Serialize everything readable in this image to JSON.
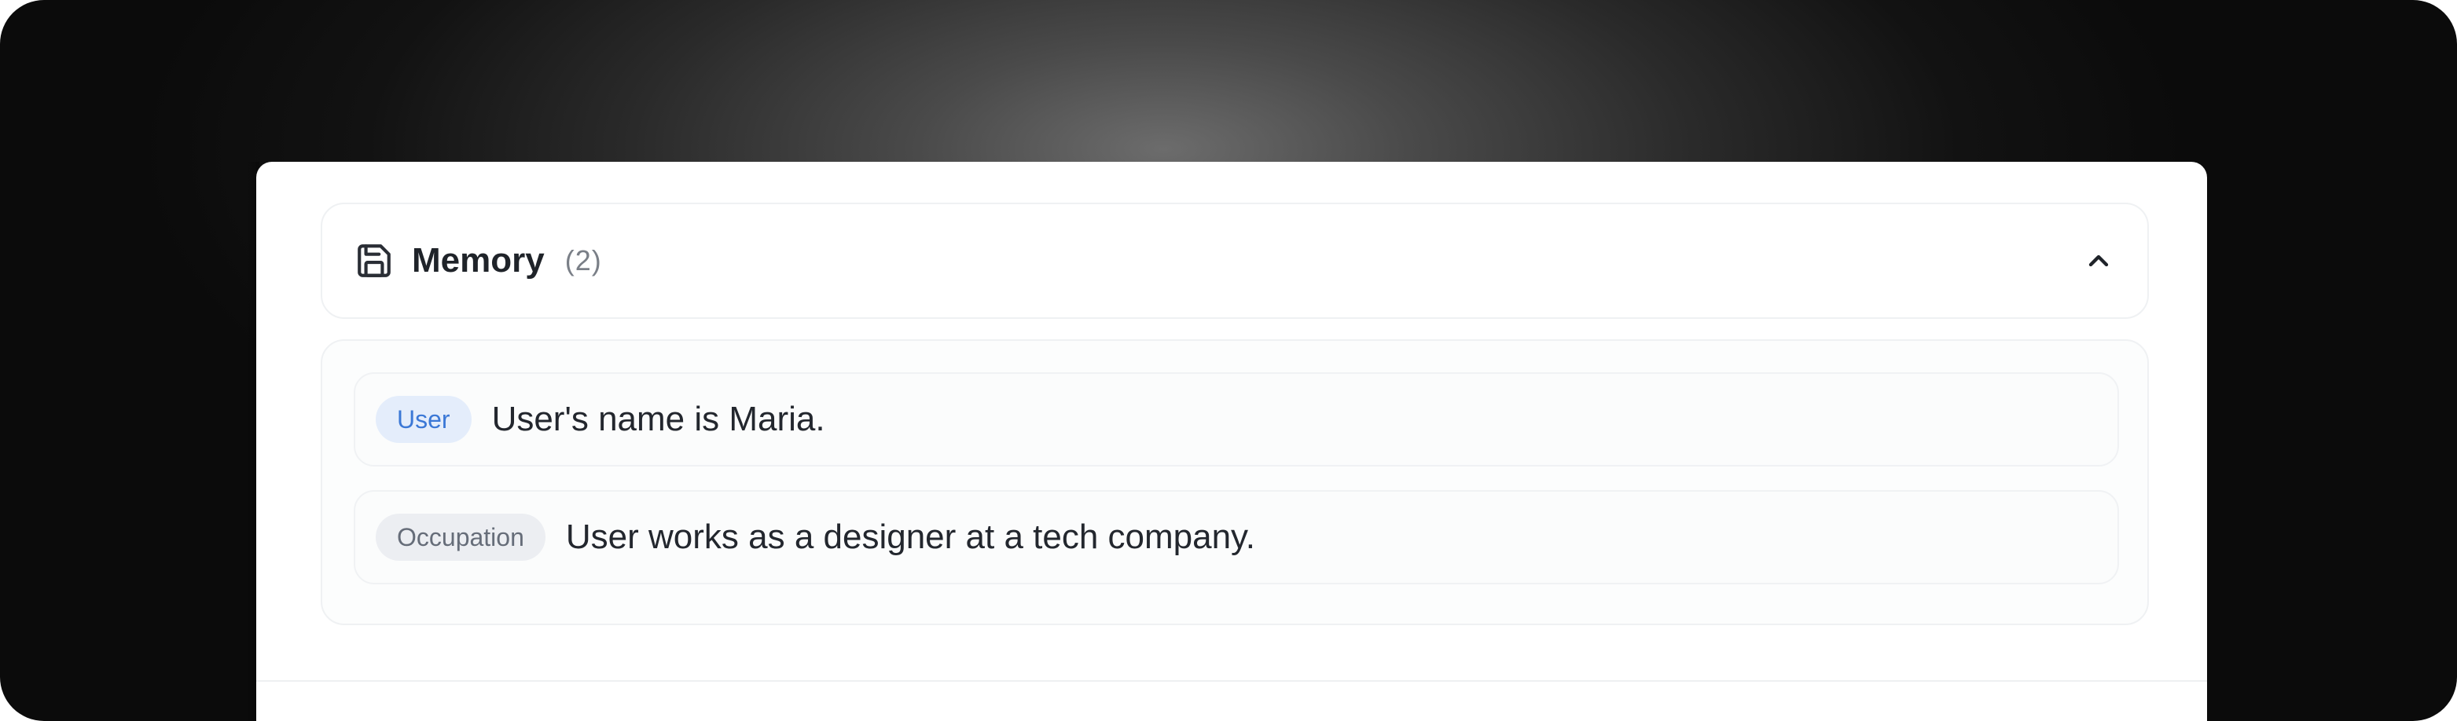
{
  "memory": {
    "title": "Memory",
    "count": "(2)",
    "icon": "save-icon",
    "toggle_icon": "chevron-up-icon",
    "items": [
      {
        "tag": "User",
        "text": "User's name is Maria."
      },
      {
        "tag": "Occupation",
        "text": "User works as a designer at a tech company."
      }
    ]
  },
  "colors": {
    "user_tag_bg": "#e4edfb",
    "user_tag_text": "#3b78d6",
    "occupation_tag_bg": "#eceef2",
    "occupation_tag_text": "#666d79"
  }
}
